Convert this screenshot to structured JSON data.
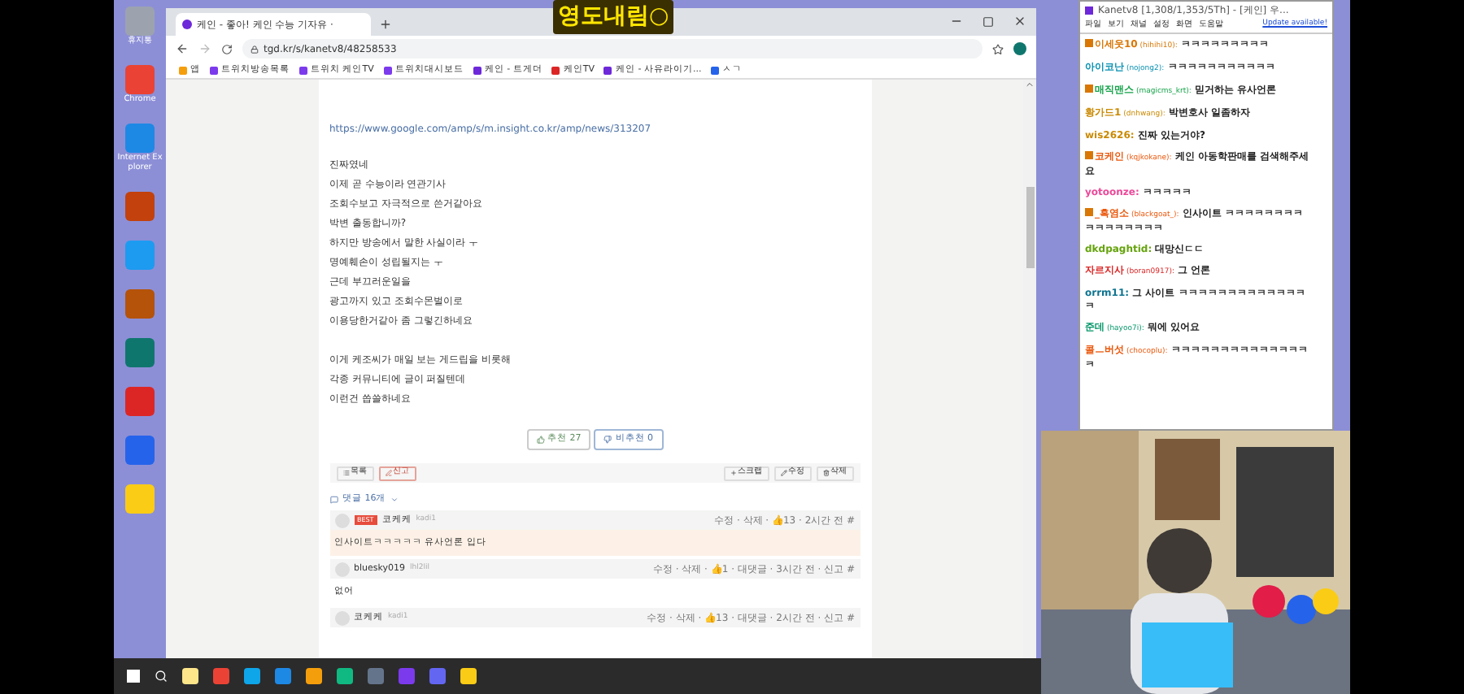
{
  "overlay_title": "영도내림○",
  "desktop_icons": [
    {
      "label": "휴지통",
      "color": "#9ca3af"
    },
    {
      "label": "Chrome",
      "color": "#ea4335"
    },
    {
      "label": "Internet Explorer",
      "color": "#1e88e5"
    },
    {
      "color": "#c2410c"
    },
    {
      "color": "#1d9bf0"
    },
    {
      "color": "#b45309"
    },
    {
      "color": "#0f766e"
    },
    {
      "color": "#dc2626"
    },
    {
      "color": "#2563eb"
    },
    {
      "color": "#facc15"
    }
  ],
  "browser": {
    "tab": "케인 - 좋아! 케인 수능 기자유 ·",
    "url": "tgd.kr/s/kanetv8/48258533",
    "bookmarks": [
      {
        "label": "앱",
        "color": "#f59e0b"
      },
      {
        "label": "트위치방송목록",
        "color": "#7c3aed"
      },
      {
        "label": "트위치 케인TV",
        "color": "#7c3aed"
      },
      {
        "label": "트위치대시보드",
        "color": "#7c3aed"
      },
      {
        "label": "케인 - 트게더",
        "color": "#6d28d9"
      },
      {
        "label": "케인TV",
        "color": "#dc2626"
      },
      {
        "label": "케인 - 사유라이기...",
        "color": "#6d28d9"
      },
      {
        "label": "ㅅㄱ",
        "color": "#2563eb"
      }
    ]
  },
  "article": {
    "link": "https://www.google.com/amp/s/m.insight.co.kr/amp/news/313207",
    "paragraphs": [
      [
        "진짜였네",
        "이제 곧 수능이라 연관기사",
        "조회수보고 자극적으로 쓴거같아요",
        "박변 출동합니까?",
        "하지만 방송에서 말한 사실이라 ㅜ",
        "명예훼손이 성립될지는 ㅜ",
        "근데 부끄러운일을",
        "광고까지 있고 조회수몬벌이로",
        "이용당한거같아 좀 그렇긴하네요"
      ],
      [
        "이게 케조씨가 매일 보는 게드립을 비롯해",
        "각종 커뮤니티에 글이 퍼질텐데",
        "이런건 씁쓸하네요"
      ]
    ],
    "upvote": "추천 27",
    "downvote": "비추천 0",
    "left_actions": [
      {
        "label": "목록",
        "kind": "plain"
      },
      {
        "label": "신고",
        "kind": "danger"
      }
    ],
    "right_actions": [
      "스크랩",
      "수정",
      "삭제"
    ]
  },
  "comments": {
    "header": "댓글 16개",
    "items": [
      {
        "author": "코케케",
        "id": "kadi1",
        "best": true,
        "best_label": "BEST",
        "meta": "수정 · 삭제 · 👍13 · 2시간 전 #",
        "text": "인사이트ㅋㅋㅋㅋㅋ 유사언론 입다"
      },
      {
        "author": "bluesky019",
        "id": "lhl2lil",
        "best": false,
        "meta": "수정 · 삭제 · 👍1 · 대댓글 · 3시간 전 · 신고 #",
        "text": "없어"
      },
      {
        "author": "코케케",
        "id": "kadi1",
        "best": false,
        "meta": "수정 · 삭제 · 👍13 · 대댓글 · 2시간 전 · 신고 #"
      }
    ]
  },
  "chat": {
    "title": "Kanetv8 [1,308/1,353/5Th] - [케인] 우...",
    "menu": [
      "파일",
      "보기",
      "채널",
      "설정",
      "화면",
      "도움말"
    ],
    "update": "Update available!",
    "messages": [
      {
        "nick": "이세웃10",
        "id": "(hihihi10):",
        "color": "#d97706",
        "badge": true,
        "text": "ㅋㅋㅋㅋㅋㅋㅋㅋㅋ"
      },
      {
        "nick": "아이코난",
        "id": "(nojong2):",
        "color": "#0891b2",
        "badge": false,
        "text": "ㅋㅋㅋㅋㅋㅋㅋㅋㅋㅋㅋ"
      },
      {
        "nick": "매직맨스",
        "id": "(magicms_krt):",
        "color": "#16a34a",
        "badge": true,
        "text": "믿거하는 유사언론"
      },
      {
        "nick": "황가드1",
        "id": "(dnhwang):",
        "color": "#ca8a04",
        "badge": false,
        "text": "박변호사 일좀하자"
      },
      {
        "nick": "wis2626:",
        "color": "#ca8a04",
        "badge": false,
        "text": "진짜 있는거야?"
      },
      {
        "nick": "코케인",
        "id": "(kqjkokane):",
        "color": "#ea580c",
        "badge": true,
        "text": "케인 아동학판매를 검색해주세요"
      },
      {
        "nick": "yotoonze:",
        "color": "#ec4899",
        "badge": false,
        "text": "ㅋㅋㅋㅋㅋ"
      },
      {
        "nick": "_흑염소",
        "id": "(blackgoat_):",
        "color": "#ea580c",
        "badge": true,
        "text": "인사이트 ㅋㅋㅋㅋㅋㅋㅋㅋㅋㅋㅋㅋㅋㅋㅋㅋ"
      },
      {
        "nick": "dkdpaghtid:",
        "color": "#65a30d",
        "badge": false,
        "text": "대망신ㄷㄷ"
      },
      {
        "nick": "자르지사",
        "id": "(boran0917):",
        "color": "#dc2626",
        "badge": false,
        "text": "그 언론"
      },
      {
        "nick": "orrm11:",
        "color": "#0e7490",
        "badge": false,
        "text": "그 사이트 ㅋㅋㅋㅋㅋㅋㅋㅋㅋㅋㅋㅋㅋㅋ"
      },
      {
        "nick": "준데",
        "id": "(hayoo7i):",
        "color": "#059669",
        "badge": false,
        "text": "뭐에 있어요"
      },
      {
        "nick": "콜ㅡ버섯",
        "id": "(chocoplu):",
        "color": "#ea580c",
        "badge": false,
        "text": "ㅋㅋㅋㅋㅋㅋㅋㅋㅋㅋㅋㅋㅋㅋㅋ"
      }
    ]
  },
  "taskbar": {
    "apps": [
      {
        "color": "#fde68a"
      },
      {
        "color": "#ea4335"
      },
      {
        "color": "#0ea5e9"
      },
      {
        "color": "#1e88e5"
      },
      {
        "color": "#f59e0b"
      },
      {
        "color": "#10b981"
      },
      {
        "color": "#64748b"
      },
      {
        "color": "#7c3aed"
      },
      {
        "color": "#6366f1"
      },
      {
        "color": "#facc15"
      }
    ]
  }
}
